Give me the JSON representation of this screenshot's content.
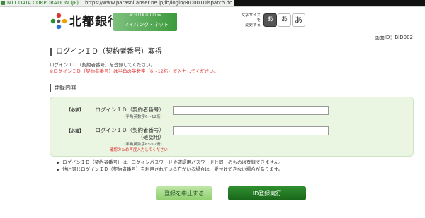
{
  "address_bar": {
    "org": "NTT DATA CORPORATION (JP)",
    "url": "https://www.parasol.anser.ne.jp/ib/login/BID001Dispatch.do"
  },
  "header": {
    "logo_text": "北都銀行",
    "brand_hokuto": "≪HOKUTO≫",
    "brand_sub": "マイバンク・ネット",
    "fontsize_label": "文字サイズを\n変更する",
    "fontsize_buttons": [
      "あ",
      "あ",
      "あ"
    ]
  },
  "screen_id": "画面ID：BID002",
  "page": {
    "title": "ログインＩＤ（契約者番号）取得",
    "desc1": "ログインＩＤ（契約者番号）を登録してください。",
    "desc2": "※ログインＩＤ（契約者番号）は半角の英数字（6～12桁）で入力してください。"
  },
  "form": {
    "section_title": "登録内容",
    "required": "【必須】",
    "field1": {
      "label": "ログインＩＤ（契約者番号）",
      "hint": "（半角英数字6～12桁）",
      "value": ""
    },
    "field2": {
      "label_line1": "ログインＩＤ（契約者番号）",
      "label_line2": "（確認用）",
      "hint": "（半角英数字6～12桁）",
      "note": "確認のため再度入力してください",
      "value": ""
    }
  },
  "notes": [
    "ログインＩＤ（契約者番号）は、ログインパスワードや確認用パスワードと同一のものは登録できません。",
    "他に同じログインＩＤ（契約者番号）を利用されている方がいる場合は、受付けできない場合があります。"
  ],
  "buttons": {
    "cancel": "登録を中止する",
    "submit": "ID登録実行"
  },
  "colors": {
    "brand_green": "#3c9a3c",
    "warning_red": "#e03030",
    "form_bg": "#eaf5e2"
  }
}
